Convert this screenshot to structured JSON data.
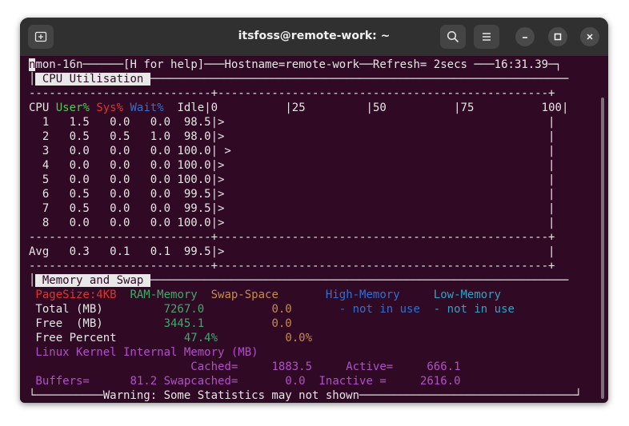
{
  "window": {
    "title": "itsfoss@remote-work: ~",
    "controls": [
      "new-tab-icon",
      "search-icon",
      "hamburger-menu-icon",
      "minimize-icon",
      "maximize-icon",
      "close-icon"
    ]
  },
  "terminal": {
    "top_border": {
      "cursor": "n",
      "prefix": "mon-16n",
      "help": "[H for help]",
      "hostname": "Hostname=remote-work",
      "refresh": "Refresh= 2secs",
      "time": "16:31.39"
    },
    "cpu": {
      "header": " CPU Utilisation ",
      "separator": "---------------------------+-------------------------------------------------+",
      "col_cpu": "CPU",
      "col_user": "User%",
      "col_sys": "Sys%",
      "col_wait": "Wait%",
      "col_idle": "Idle|0",
      "scale": "          |25         |50          |75          100|",
      "rows": [
        "  1   1.5   0.0   0.0  98.5|>                                                |",
        "  2   0.5   0.5   1.0  98.0|>                                                |",
        "  3   0.0   0.0   0.0 100.0| >                                               |",
        "  4   0.0   0.0   0.0 100.0|>                                                |",
        "  5   0.0   0.0   0.0 100.0|>                                                |",
        "  6   0.5   0.0   0.0  99.5|>                                                |",
        "  7   0.5   0.0   0.0  99.5|>                                                |",
        "  8   0.0   0.0   0.0 100.0|>                                                |"
      ],
      "avg": "Avg   0.3   0.1   0.1  99.5|>                                                |"
    },
    "memory": {
      "header": " Memory and Swap ",
      "pagesize": " PageSize:4KB",
      "ram_hdr": "RAM-Memory",
      "swap_hdr": "Swap-Space",
      "high_hdr": "High-Memory",
      "low_hdr": "Low-Memory",
      "total_label": " Total (MB)",
      "total_ram": "7267.0",
      "total_swap": "0.0",
      "high_status": "- not in use",
      "low_status": "- not in use",
      "free_label": " Free  (MB)",
      "free_ram": "3445.1",
      "free_swap": "0.0",
      "pct_label": " Free Percent",
      "pct_ram": "47.4%",
      "pct_swap": "0.0%",
      "kernel_label": " Linux Kernel Internal Memory (MB)",
      "cached_label": "Cached=",
      "cached": "1883.5",
      "active_label": "Active=",
      "active": "666.1",
      "buffers_label": " Buffers=",
      "buffers": "81.2",
      "swapcached_label": "Swapcached=",
      "swapcached": "0.0",
      "inactive_label": "Inactive =",
      "inactive": "2616.0"
    },
    "warning": "Warning: Some Statistics may not shown"
  },
  "colors": {
    "terminal_bg": "#300a24",
    "user": "#4ec94e",
    "sys": "#e0332b",
    "wait": "#2f6fd4",
    "kernel": "#b050c8",
    "swap": "#c68a4a",
    "status": "#2fa2c4"
  }
}
